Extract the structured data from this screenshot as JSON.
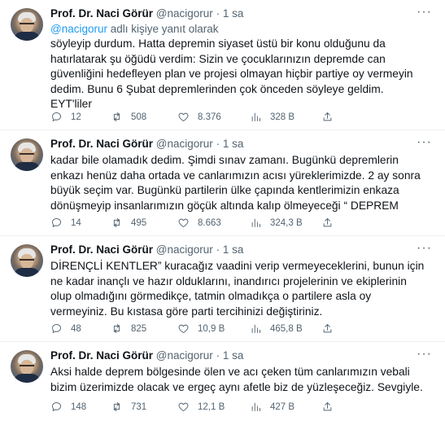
{
  "tweets": [
    {
      "name": "Prof. Dr. Naci Görür",
      "handle": "@nacigorur",
      "dot": "·",
      "time": "1 sa",
      "reply_mention": "@nacigorur",
      "reply_suffix": " adlı kişiye yanıt olarak",
      "text": "söyleyip durdum. Hatta depremin siyaset üstü bir konu olduğunu da\nhatırlatarak şu öğüdü verdim: Sizin ve çocuklarınızın depremde can\ngüvenliğini hedefleyen  plan ve projesi olmayan hiçbir partiye oy vermeyin\ndedim. Bunu 6 Şubat depremlerinden çok önceden söyleye geldim.\nEYT'liler",
      "replies": "12",
      "retweets": "508",
      "likes": "8.376",
      "views": "328 B"
    },
    {
      "name": "Prof. Dr. Naci Görür",
      "handle": "@nacigorur",
      "dot": "·",
      "time": "1 sa",
      "text": "kadar bile olamadık dedim. Şimdi sınav zamanı. Bugünkü depremlerin\nenkazı henüz daha ortada ve canlarımızın acısı yüreklerimizde. 2 ay sonra\nbüyük seçim var. Bugünkü partilerin ülke çapında kentlerimizin enkaza\ndönüşmeyip insanlarımızın göçük altında kalıp ölmeyeceği “ DEPREM",
      "replies": "14",
      "retweets": "495",
      "likes": "8.663",
      "views": "324,3 B"
    },
    {
      "name": "Prof. Dr. Naci Görür",
      "handle": "@nacigorur",
      "dot": "·",
      "time": "1 sa",
      "text": "DİRENÇLİ KENTLER” kuracağız vaadini verip vermeyeceklerini, bunun için\nne kadar inançlı ve hazır olduklarını, inandırıcı projelerinin ve ekiplerinin\nolup olmadığını görmedikçe, tatmin olmadıkça o partilere asla oy\nvermeyiniz. Bu kıstasa göre parti tercihinizi değiştiriniz.",
      "replies": "48",
      "retweets": "825",
      "likes": "10,9 B",
      "views": "465,8 B"
    },
    {
      "name": "Prof. Dr. Naci Görür",
      "handle": "@nacigorur",
      "dot": "·",
      "time": "1 sa",
      "text": "Aksi halde deprem bölgesinde ölen ve acı çeken tüm canlarımızın vebali\nbizim üzerimizde olacak ve ergeç aynı afetle biz de yüzleşeceğiz. Sevgiyle.",
      "replies": "148",
      "retweets": "731",
      "likes": "12,1 B",
      "views": "427 B"
    }
  ],
  "icons": {
    "more": "more-horizontal-icon",
    "reply": "reply-bubble-icon",
    "retweet": "retweet-icon",
    "like": "heart-icon",
    "views": "views-chart-icon",
    "share": "share-upload-icon"
  },
  "colors": {
    "text": "#0f1419",
    "secondary": "#536471",
    "link": "#1d9bf0",
    "divider": "#eff3f4"
  }
}
